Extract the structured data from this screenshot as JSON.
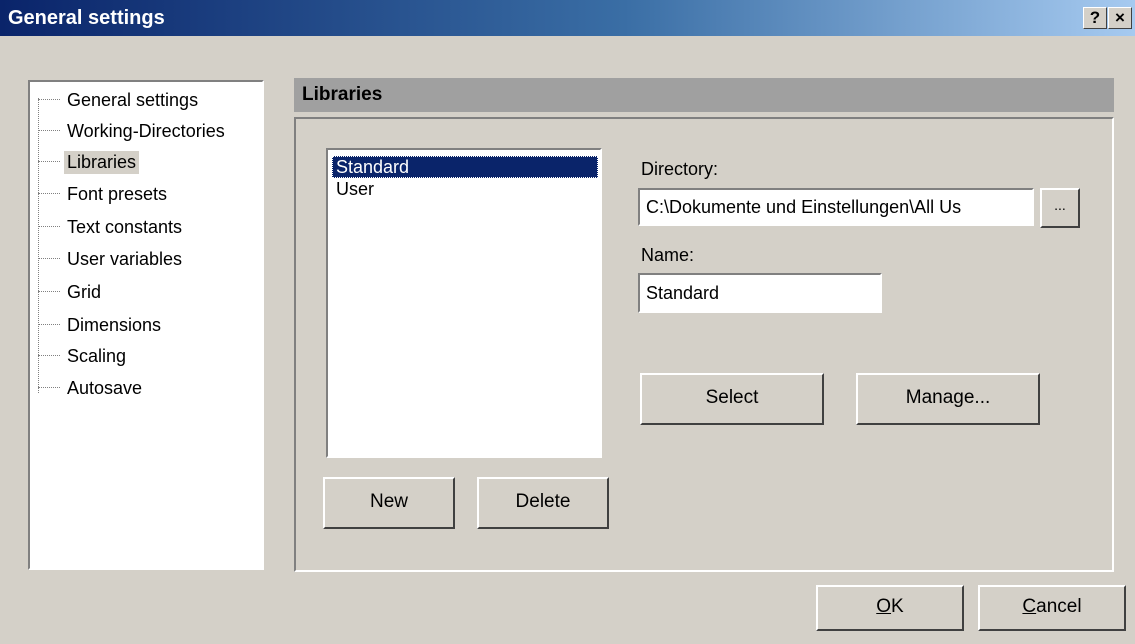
{
  "window": {
    "title": "General settings",
    "help_label": "?",
    "close_label": "×"
  },
  "tree": {
    "items": [
      {
        "label": "General settings"
      },
      {
        "label": "Working-Directories"
      },
      {
        "label": "Libraries",
        "selected": true
      },
      {
        "label": "Font presets"
      },
      {
        "label": "Text constants"
      },
      {
        "label": "User variables"
      },
      {
        "label": "Grid"
      },
      {
        "label": "Dimensions"
      },
      {
        "label": "Scaling"
      },
      {
        "label": "Autosave"
      }
    ]
  },
  "section": {
    "header": "Libraries"
  },
  "libraries": {
    "items": [
      {
        "label": "Standard",
        "selected": true
      },
      {
        "label": "User"
      }
    ]
  },
  "form": {
    "directory_label": "Directory:",
    "directory_value": "C:\\Dokumente und Einstellungen\\All Us",
    "browse_label": "...",
    "name_label": "Name:",
    "name_value": "Standard"
  },
  "buttons": {
    "select": "Select",
    "manage": "Manage...",
    "new": "New",
    "delete": "Delete",
    "ok_mnemonic": "O",
    "ok_rest": "K",
    "cancel_mnemonic": "C",
    "cancel_rest": "ancel"
  },
  "colors": {
    "selection": "#0a246a",
    "face": "#d4d0c8",
    "header": "#a0a0a0"
  }
}
